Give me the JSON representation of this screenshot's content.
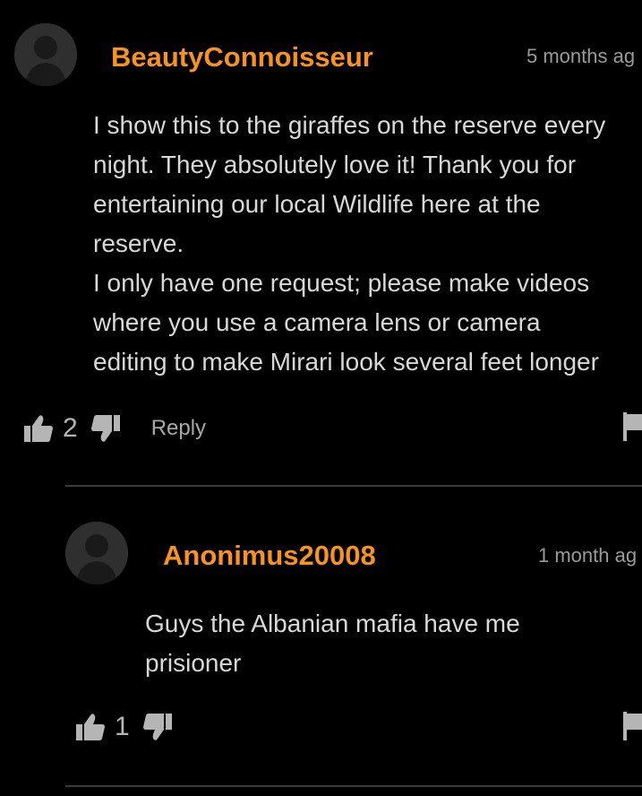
{
  "colors": {
    "background": "#000000",
    "username": "#f7931e",
    "body_text": "#d8d8d8",
    "muted": "#9a9a9a",
    "divider": "#3a3a3a"
  },
  "comments": [
    {
      "username": "BeautyConnoisseur",
      "timestamp": "5 months ag",
      "body_lines": [
        "I show this to the giraffes on the reserve every",
        "night. They absolutely love it! Thank you for",
        "entertaining our local Wildlife here at the",
        "reserve.",
        "I only have one request; please make videos",
        "where you use a camera lens or camera",
        "editing to make Mirari look several feet longer"
      ],
      "likes": "2",
      "reply_label": "Reply",
      "icons": [
        "avatar-placeholder-icon",
        "thumbs-up-icon",
        "thumbs-down-icon",
        "flag-icon"
      ]
    },
    {
      "username": "Anonimus20008",
      "timestamp": "1 month ag",
      "body_lines": [
        "Guys the Albanian mafia have me",
        "prisioner"
      ],
      "likes": "1",
      "icons": [
        "avatar-placeholder-icon",
        "thumbs-up-icon",
        "thumbs-down-icon",
        "flag-icon"
      ]
    }
  ]
}
